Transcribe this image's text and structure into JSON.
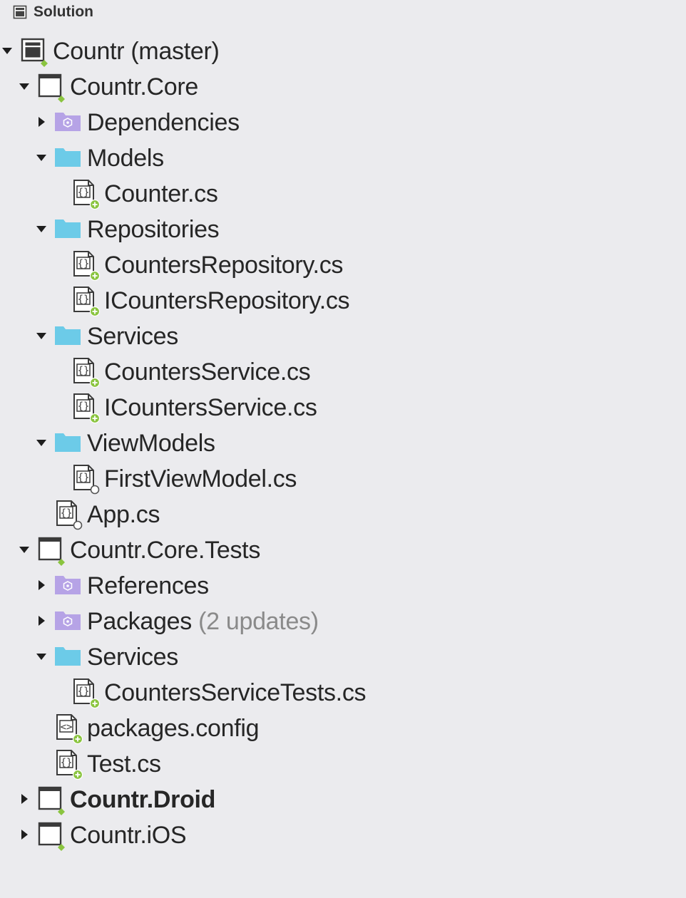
{
  "pad": {
    "title": "Solution",
    "icon": "solution-pad-icon"
  },
  "colors": {
    "background": "#ebebee",
    "folder": "#6ccbe8",
    "special_folder": "#b6a3e6",
    "status_added": "#8ac43f",
    "text": "#262626",
    "muted_text": "#8a8a8a"
  },
  "tree": [
    {
      "id": "solution",
      "label": "Countr (master)",
      "depth": 0,
      "expanded": true,
      "icon": "solution-icon",
      "status": "dot"
    },
    {
      "id": "countr-core",
      "label": "Countr.Core",
      "depth": 1,
      "expanded": true,
      "icon": "project-icon",
      "status": "dot"
    },
    {
      "id": "core-dependencies",
      "label": "Dependencies",
      "depth": 2,
      "expanded": false,
      "icon": "special-folder-icon"
    },
    {
      "id": "core-models",
      "label": "Models",
      "depth": 2,
      "expanded": true,
      "icon": "folder-icon"
    },
    {
      "id": "counter-cs",
      "label": "Counter.cs",
      "depth": 3,
      "icon": "csharp-file-icon",
      "status": "added"
    },
    {
      "id": "core-repositories",
      "label": "Repositories",
      "depth": 2,
      "expanded": true,
      "icon": "folder-icon"
    },
    {
      "id": "countersrepository-cs",
      "label": "CountersRepository.cs",
      "depth": 3,
      "icon": "csharp-file-icon",
      "status": "added"
    },
    {
      "id": "icountersrepository-cs",
      "label": "ICountersRepository.cs",
      "depth": 3,
      "icon": "csharp-file-icon",
      "status": "added"
    },
    {
      "id": "core-services",
      "label": "Services",
      "depth": 2,
      "expanded": true,
      "icon": "folder-icon"
    },
    {
      "id": "countersservice-cs",
      "label": "CountersService.cs",
      "depth": 3,
      "icon": "csharp-file-icon",
      "status": "added"
    },
    {
      "id": "icountersservice-cs",
      "label": "ICountersService.cs",
      "depth": 3,
      "icon": "csharp-file-icon",
      "status": "added"
    },
    {
      "id": "core-viewmodels",
      "label": "ViewModels",
      "depth": 2,
      "expanded": true,
      "icon": "folder-icon"
    },
    {
      "id": "firstviewmodel-cs",
      "label": "FirstViewModel.cs",
      "depth": 3,
      "icon": "csharp-file-icon",
      "status": "unversioned"
    },
    {
      "id": "app-cs",
      "label": "App.cs",
      "depth": 2,
      "icon": "csharp-file-icon",
      "status": "unversioned"
    },
    {
      "id": "countr-core-tests",
      "label": "Countr.Core.Tests",
      "depth": 1,
      "expanded": true,
      "icon": "project-icon",
      "status": "dot"
    },
    {
      "id": "tests-references",
      "label": "References",
      "depth": 2,
      "expanded": false,
      "icon": "special-folder-icon"
    },
    {
      "id": "tests-packages",
      "label": "Packages",
      "suffix": "(2 updates)",
      "depth": 2,
      "expanded": false,
      "icon": "special-folder-icon"
    },
    {
      "id": "tests-services",
      "label": "Services",
      "depth": 2,
      "expanded": true,
      "icon": "folder-icon"
    },
    {
      "id": "countersservicetests-cs",
      "label": "CountersServiceTests.cs",
      "depth": 3,
      "icon": "csharp-file-icon",
      "status": "added"
    },
    {
      "id": "packages-config",
      "label": "packages.config",
      "depth": 2,
      "icon": "xml-file-icon",
      "status": "added"
    },
    {
      "id": "test-cs",
      "label": "Test.cs",
      "depth": 2,
      "icon": "csharp-file-icon",
      "status": "added"
    },
    {
      "id": "countr-droid",
      "label": "Countr.Droid",
      "depth": 1,
      "expanded": false,
      "icon": "project-icon",
      "status": "dot",
      "bold": true
    },
    {
      "id": "countr-ios",
      "label": "Countr.iOS",
      "depth": 1,
      "expanded": false,
      "icon": "project-icon",
      "status": "dot"
    }
  ]
}
